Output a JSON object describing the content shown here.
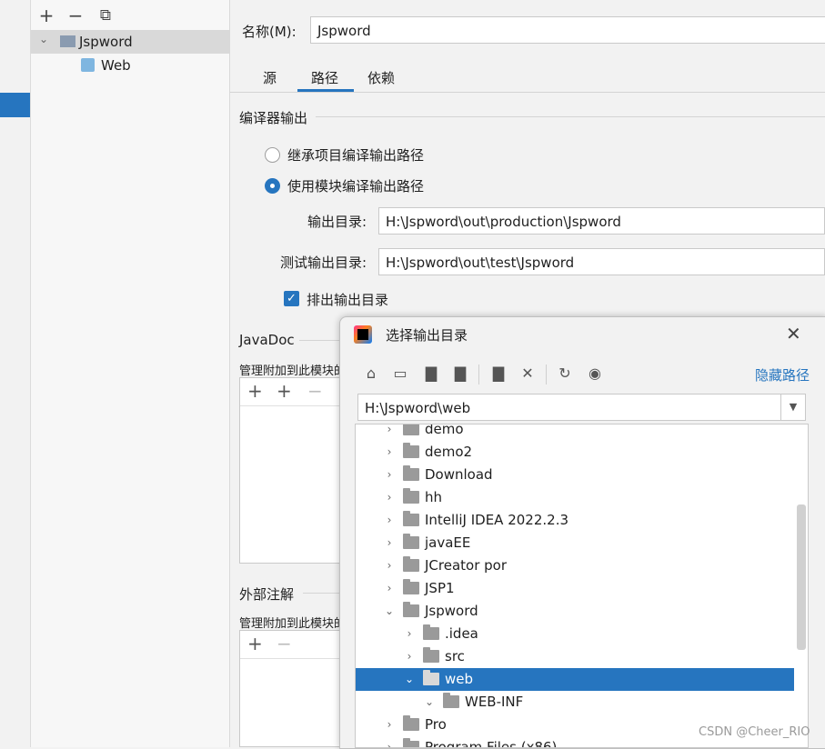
{
  "module_tree": {
    "toolbar": {
      "add": "+",
      "remove": "−",
      "copy": "⧉"
    },
    "items": [
      {
        "label": "Jspword",
        "expanded": true,
        "selected": true
      },
      {
        "label": "Web",
        "selected": false
      }
    ]
  },
  "name_field": {
    "label": "名称(M):",
    "value": "Jspword"
  },
  "tabs": [
    {
      "label": "源",
      "active": false
    },
    {
      "label": "路径",
      "active": true
    },
    {
      "label": "依赖",
      "active": false
    }
  ],
  "compiler_output": {
    "section_title": "编译器输出",
    "radio_inherit": {
      "label": "继承项目编译输出路径",
      "checked": false
    },
    "radio_module": {
      "label": "使用模块编译输出路径",
      "checked": true
    },
    "output_dir": {
      "label": "输出目录:",
      "value": "H:\\Jspword\\out\\production\\Jspword"
    },
    "test_output_dir": {
      "label": "测试输出目录:",
      "value": "H:\\Jspword\\out\\test\\Jspword"
    },
    "exclude_checkbox": {
      "label": "排出输出目录",
      "checked": true
    }
  },
  "javadoc": {
    "section_title": "JavaDoc",
    "description": "管理附加到此模块的",
    "toolbar": {
      "add": "+",
      "add_url": "+",
      "remove": "−"
    }
  },
  "external_annotations": {
    "section_title": "外部注解",
    "description": "管理附加到此模块的",
    "toolbar": {
      "add": "+",
      "remove": "−"
    }
  },
  "dialog": {
    "title": "选择输出目录",
    "hide_path_link": "隐藏路径",
    "path_value": "H:\\Jspword\\web",
    "tree": [
      {
        "label": "demo",
        "level": 0,
        "expanded": false,
        "selected": false
      },
      {
        "label": "demo2",
        "level": 0,
        "expanded": false,
        "selected": false
      },
      {
        "label": "Download",
        "level": 0,
        "expanded": false,
        "selected": false
      },
      {
        "label": "hh",
        "level": 0,
        "expanded": false,
        "selected": false
      },
      {
        "label": "IntelliJ IDEA 2022.2.3",
        "level": 0,
        "expanded": false,
        "selected": false
      },
      {
        "label": "javaEE",
        "level": 0,
        "expanded": false,
        "selected": false
      },
      {
        "label": "JCreator por",
        "level": 0,
        "expanded": false,
        "selected": false
      },
      {
        "label": "JSP1",
        "level": 0,
        "expanded": false,
        "selected": false
      },
      {
        "label": "Jspword",
        "level": 0,
        "expanded": true,
        "selected": false
      },
      {
        "label": ".idea",
        "level": 1,
        "expanded": false,
        "selected": false
      },
      {
        "label": "src",
        "level": 1,
        "expanded": false,
        "selected": false
      },
      {
        "label": "web",
        "level": 1,
        "expanded": true,
        "selected": true
      },
      {
        "label": "WEB-INF",
        "level": 2,
        "expanded": true,
        "selected": false
      },
      {
        "label": "Pro",
        "level": 0,
        "expanded": false,
        "selected": false
      },
      {
        "label": "Program Files (x86)",
        "level": 0,
        "expanded": false,
        "selected": false
      }
    ]
  },
  "watermark": "CSDN @Cheer_RIO",
  "colors": {
    "accent": "#2675bf",
    "selection_gray": "#d9d9d9",
    "link": "#2675bf"
  }
}
